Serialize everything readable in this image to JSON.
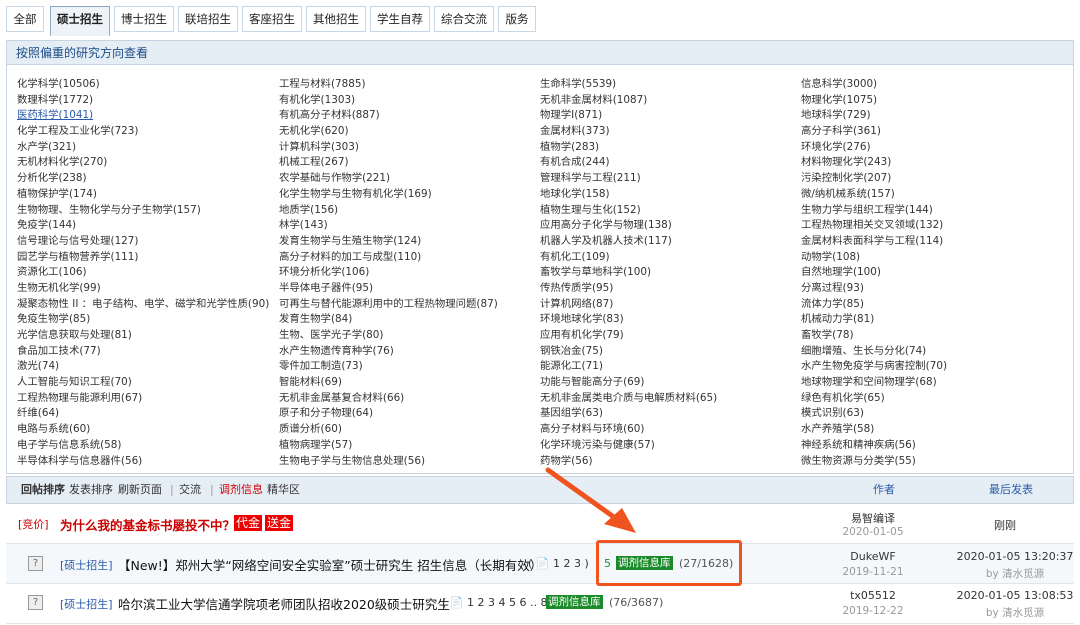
{
  "tabs": [
    "全部",
    "硕士招生",
    "博士招生",
    "联培招生",
    "客座招生",
    "其他招生",
    "学生自荐",
    "综合交流",
    "版务"
  ],
  "active_tab": 1,
  "panel": {
    "title": "按照偏重的研究方向查看",
    "columns": [
      [
        "化学科学(10506)",
        "数理科学(1772)",
        "医药科学(1041)",
        "化学工程及工业化学(723)",
        "水产学(321)",
        "无机材料化学(270)",
        "分析化学(238)",
        "植物保护学(174)",
        "生物物理、生物化学与分子生物学(157)",
        "免疫学(144)",
        "信号理论与信号处理(127)",
        "园艺学与植物营养学(111)",
        "资源化工(106)",
        "生物无机化学(99)",
        "凝聚态物性 II ：电子结构、电学、磁学和光学性质(90)",
        "免疫生物学(85)",
        "光学信息获取与处理(81)",
        "食品加工技术(77)",
        "激光(74)",
        "人工智能与知识工程(70)",
        "工程热物理与能源利用(67)",
        "纤维(64)",
        "电路与系统(60)",
        "电子学与信息系统(58)",
        "半导体科学与信息器件(56)"
      ],
      [
        "工程与材料(7885)",
        "有机化学(1303)",
        "有机高分子材料(887)",
        "无机化学(620)",
        "计算机科学(303)",
        "机械工程(267)",
        "农学基础与作物学(221)",
        "化学生物学与生物有机化学(169)",
        "地质学(156)",
        "林学(143)",
        "发育生物学与生殖生物学(124)",
        "高分子材料的加工与成型(110)",
        "环境分析化学(106)",
        "半导体电子器件(95)",
        "可再生与替代能源利用中的工程热物理问题(87)",
        "发育生物学(84)",
        "生物、医学光子学(80)",
        "水产生物遗传育种学(76)",
        "零件加工制造(73)",
        "智能材料(69)",
        "无机非金属基复合材料(66)",
        "原子和分子物理(64)",
        "质谱分析(60)",
        "植物病理学(57)",
        "生物电子学与生物信息处理(56)"
      ],
      [
        "生命科学(5539)",
        "无机非金属材料(1087)",
        "物理学I(871)",
        "金属材料(373)",
        "植物学(283)",
        "有机合成(244)",
        "管理科学与工程(211)",
        "地球化学(158)",
        "植物生理与生化(152)",
        "应用高分子化学与物理(138)",
        "机器人学及机器人技术(117)",
        "有机化工(109)",
        "畜牧学与草地科学(100)",
        "传热传质学(95)",
        "计算机网络(87)",
        "环境地球化学(83)",
        "应用有机化学(79)",
        "钢铁冶金(75)",
        "能源化工(71)",
        "功能与智能高分子(69)",
        "无机非金属类电介质与电解质材料(65)",
        "基因组学(63)",
        "高分子材料与环境(60)",
        "化学环境污染与健康(57)",
        "药物学(56)"
      ],
      [
        "信息科学(3000)",
        "物理化学(1075)",
        "地球科学(729)",
        "高分子科学(361)",
        "环境化学(276)",
        "材料物理化学(243)",
        "污染控制化学(207)",
        "微/纳机械系统(157)",
        "生物力学与组织工程学(144)",
        "工程热物理相关交叉领域(132)",
        "金属材料表面科学与工程(114)",
        "动物学(108)",
        "自然地理学(100)",
        "分离过程(93)",
        "流体力学(85)",
        "机械动力学(81)",
        "畜牧学(78)",
        "细胞增殖、生长与分化(74)",
        "水产生物免疫学与病害控制(70)",
        "地球物理学和空间物理学(68)",
        "绿色有机化学(65)",
        "模式识别(63)",
        "水产养殖学(58)",
        "神经系统和精神疾病(56)",
        "微生物资源与分类学(55)"
      ]
    ]
  },
  "list_header": {
    "sort_reply": "回帖排序",
    "sort_post": "发表排序",
    "refresh": "刷新页面",
    "sep1": "|",
    "exchange": "交流",
    "sep2": "|",
    "adjust": "调剂信息",
    "elite": "精华区",
    "author": "作者",
    "last_post": "最后发表"
  },
  "rows": [
    {
      "tag": "[竞价]",
      "title": "为什么我的基金标书屡投不中？",
      "badge1": "代金",
      "badge2": "送金",
      "author": "易智编译",
      "date": "2020-01-05",
      "last": "刚刚"
    },
    {
      "icon": "?",
      "forum": "[硕士招生]",
      "title": "【New!】郑州大学“网络空间安全实验室”硕士研究生 招生信息（长期有效）",
      "pages": "( 📄 1 2 3 )",
      "extra": "5",
      "badge": "调剂信息库",
      "count": "(27/1628)",
      "author": "DukeWF",
      "date": "2019-11-21",
      "last": "2020-01-05 13:20:37",
      "by": "by 清水觅源"
    },
    {
      "icon": "?",
      "forum": "[硕士招生]",
      "title": "哈尔滨工业大学信通学院项老师团队招收2020级硕士研究生",
      "pages": "( 📄 1 2 3 4 5 6 .. 8 )",
      "badge": "调剂信息库",
      "count": "(76/3687)",
      "author": "tx05512",
      "date": "2019-12-22",
      "last": "2020-01-05 13:08:53",
      "by": "by 清水觅源"
    }
  ],
  "colors": {
    "accent": "#2b5ba8",
    "highlight": "#f0541e",
    "green": "#1b8a2a",
    "red": "#cc0000"
  }
}
